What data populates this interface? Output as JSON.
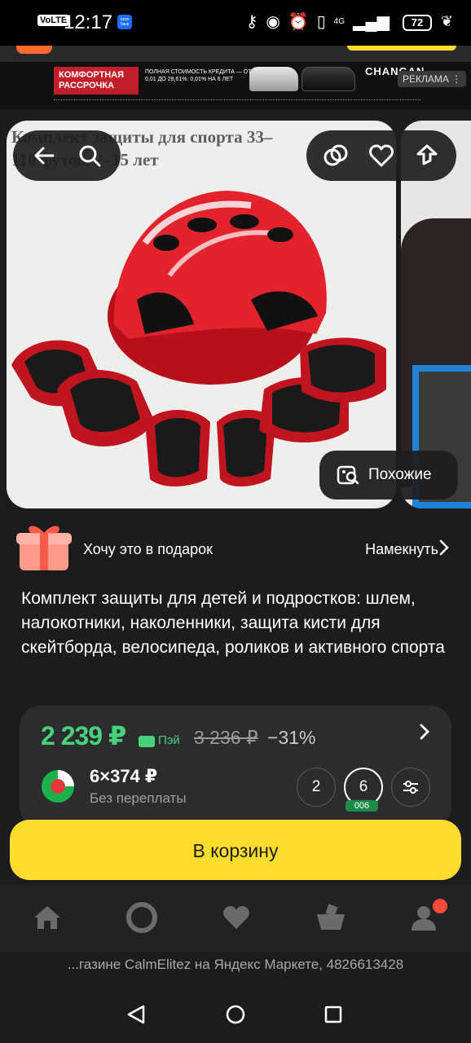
{
  "status_bar": {
    "volte": "VoLTE",
    "time": "12:17",
    "app_badge": "ozon банк",
    "network": "4G",
    "battery": "72"
  },
  "ad": {
    "headline": "КОМФОРТНАЯ РАССРОЧКА",
    "text": "ПОЛНАЯ СТОИМОСТЬ КРЕДИТА — ОТ 0,01 ДО 28,61%. 0,01% НА 6 ЛЕТ",
    "brand": "CHANGAN",
    "label": "РЕКЛАМА"
  },
  "product": {
    "overlay_title": "Комплект защиты для спорта 33–110 футов, 2–15 лет",
    "similar_label": "Похожие",
    "title": "Комплект защиты для детей и подростков: шлем, налокотники, наколенники, защита кисти для скейтборда, велосипеда, роликов и активного спорта"
  },
  "gift": {
    "label": "Хочу это в подарок",
    "action": "Намекнуть"
  },
  "price": {
    "current": "2 239 ₽",
    "pay_label": "Пэй",
    "old": "3 236 ₽",
    "discount": "−31%",
    "split_title": "6×374 ₽",
    "split_sub": "Без переплаты",
    "options": [
      "2",
      "6"
    ],
    "selected_option": "6",
    "badge": "006"
  },
  "cart_button": "В корзину",
  "footer": "...газине CalmElitez на Яндекс Маркете, 4826613428",
  "colors": {
    "accent_yellow": "#ffdd2d",
    "price_green": "#48d07d",
    "background": "#1c1c1e",
    "notification": "#ff4a35"
  },
  "icons": [
    "back-arrow-icon",
    "search-icon",
    "compare-icon",
    "heart-icon",
    "share-icon",
    "similar-search-icon",
    "gift-icon",
    "chevron-right-icon",
    "split-payment-icon",
    "filter-icon",
    "home-icon",
    "alice-icon",
    "favorites-icon",
    "cart-icon",
    "profile-icon"
  ]
}
